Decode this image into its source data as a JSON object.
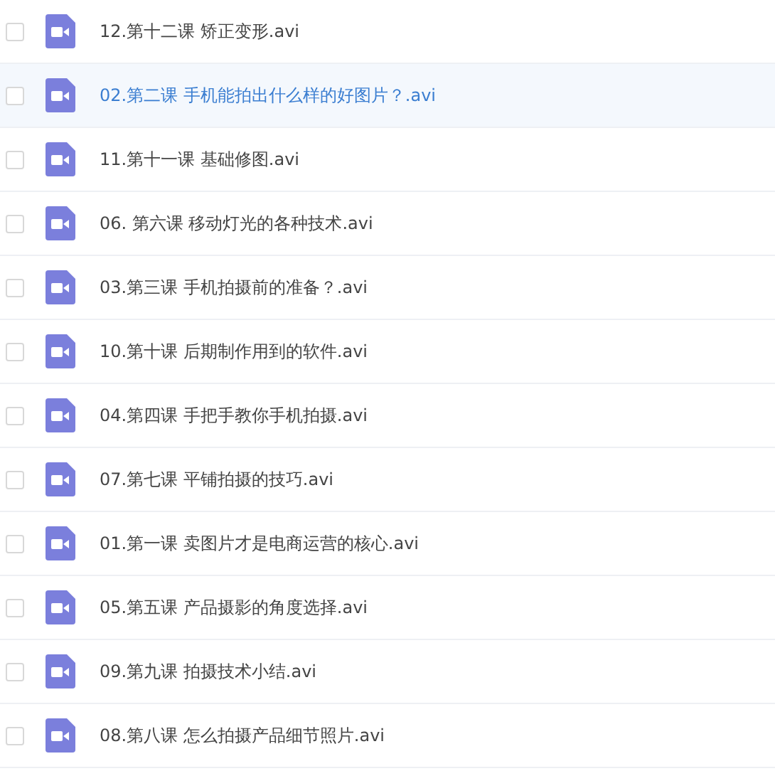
{
  "files": [
    {
      "name": "12.第十二课 矫正变形.avi",
      "checked": false,
      "selected": false
    },
    {
      "name": "02.第二课 手机能拍出什么样的好图片？.avi",
      "checked": false,
      "selected": true
    },
    {
      "name": "11.第十一课 基础修图.avi",
      "checked": false,
      "selected": false
    },
    {
      "name": "06. 第六课 移动灯光的各种技术.avi",
      "checked": false,
      "selected": false
    },
    {
      "name": "03.第三课 手机拍摄前的准备？.avi",
      "checked": false,
      "selected": false
    },
    {
      "name": "10.第十课 后期制作用到的软件.avi",
      "checked": false,
      "selected": false
    },
    {
      "name": "04.第四课 手把手教你手机拍摄.avi",
      "checked": false,
      "selected": false
    },
    {
      "name": "07.第七课 平铺拍摄的技巧.avi",
      "checked": false,
      "selected": false
    },
    {
      "name": "01.第一课 卖图片才是电商运营的核心.avi",
      "checked": false,
      "selected": false
    },
    {
      "name": "05.第五课 产品摄影的角度选择.avi",
      "checked": false,
      "selected": false
    },
    {
      "name": "09.第九课 拍摄技术小结.avi",
      "checked": false,
      "selected": false
    },
    {
      "name": "08.第八课 怎么拍摄产品细节照片.avi",
      "checked": false,
      "selected": false
    }
  ]
}
